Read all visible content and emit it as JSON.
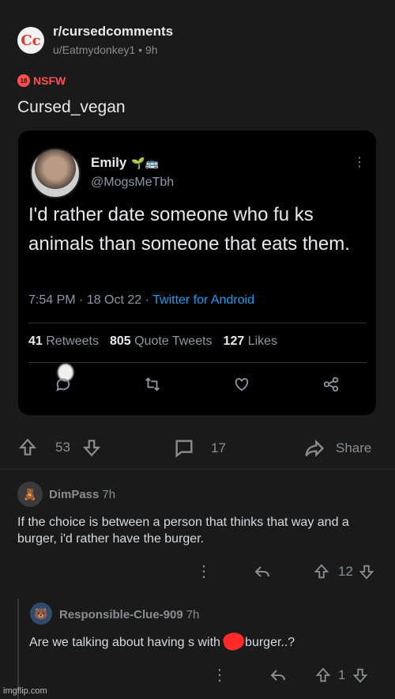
{
  "post": {
    "subreddit": "r/cursedcomments",
    "subreddit_icon_letter": "Cc",
    "author": "u/Eatmydonkey1",
    "age": "9h",
    "nsfw_label": "NSFW",
    "nsfw_badge": "18",
    "title": "Cursed_vegan",
    "upvotes": "53",
    "comments": "17",
    "share_label": "Share"
  },
  "tweet": {
    "name": "Emily",
    "name_emoji": "🌱🚌",
    "handle": "@MogsMeTbh",
    "text": "I'd rather date someone who fu  ks animals than someone that eats them.",
    "time": "7:54 PM",
    "date": "18 Oct 22",
    "source": "Twitter for Android",
    "retweets_count": "41",
    "retweets_label": "Retweets",
    "quotes_count": "805",
    "quotes_label": "Quote Tweets",
    "likes_count": "127",
    "likes_label": "Likes"
  },
  "comments": [
    {
      "user": "DimPass",
      "age": "7h",
      "text": "If the choice is between a person that thinks that way and a burger, i'd rather have the burger.",
      "score": "12"
    },
    {
      "user": "Responsible-Clue-909",
      "age": "7h",
      "text": "Are we talking about having s    with the burger..?",
      "score": "1"
    }
  ],
  "watermark": "imgflip.com",
  "colors": {
    "background": "#1a1a1b",
    "nsfw": "#ff4f4f",
    "twitter_link": "#1d9bf0"
  }
}
